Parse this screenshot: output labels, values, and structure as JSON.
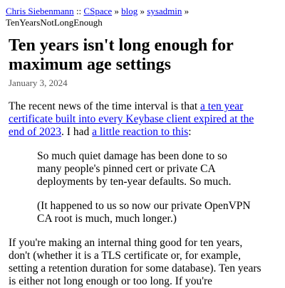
{
  "breadcrumb": {
    "author": "Chris Siebenmann",
    "sep1": " :: ",
    "space": "CSpace",
    "sep2": " » ",
    "blog": "blog",
    "sep3": " » ",
    "category": "sysadmin",
    "sep4": " »",
    "current": "TenYearsNotLongEnough"
  },
  "article": {
    "title": "Ten years isn't long enough for maximum age settings",
    "date": "January 3, 2024",
    "p1_text1": "The recent news of the time interval is that ",
    "p1_link1": "a ten year certificate built into every Keybase client expired at the end of 2023",
    "p1_text2": ". I had ",
    "p1_link2": "a little reaction to this",
    "p1_text3": ":",
    "quote1": "So much quiet damage has been done to so many people's pinned cert or private CA deployments by ten-year defaults. So much.",
    "quote2": "(It happened to us so now our private OpenVPN CA root is much, much longer.)",
    "p2": "If you're making an internal thing good for ten years, don't (whether it is a TLS certificate or, for example, setting a retention duration for some database). Ten years is either not long enough or too long. If you're"
  }
}
